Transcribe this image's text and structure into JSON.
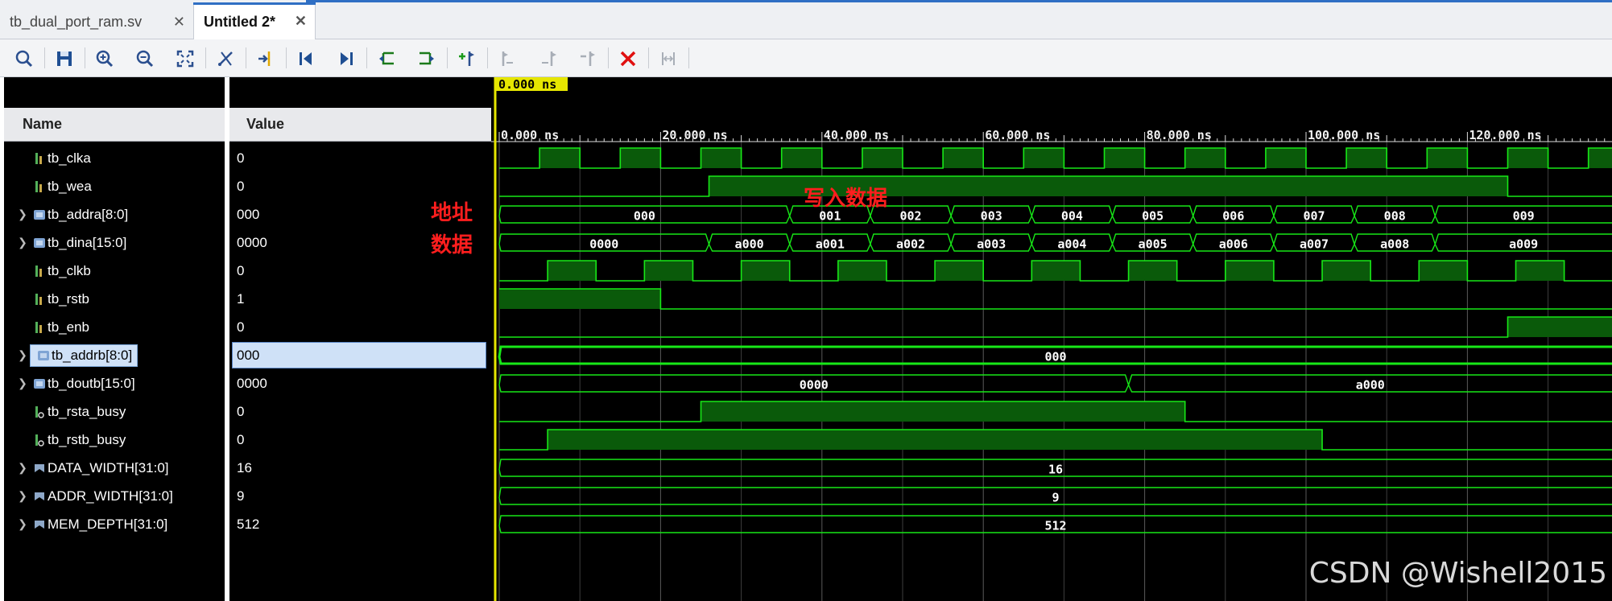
{
  "tabs": [
    {
      "label": "tb_dual_port_ram.sv",
      "active": false
    },
    {
      "label": "Untitled 2*",
      "active": true
    }
  ],
  "toolbar": {
    "buttons": [
      "search-icon",
      "save-icon",
      "zoom-in-icon",
      "zoom-out-icon",
      "zoom-fit-icon",
      "swap-cursor-icon",
      "go-to-cursor-icon",
      "go-to-start-icon",
      "go-to-end-icon",
      "previous-transition-icon",
      "next-transition-icon",
      "add-marker-icon",
      "previous-marker-icon",
      "next-marker-icon",
      "remove-marker-icon",
      "delete-icon",
      "snap-icon"
    ]
  },
  "columns": {
    "name": "Name",
    "value": "Value"
  },
  "signals": [
    {
      "name": "tb_clka",
      "value": "0",
      "expandable": false,
      "icon": "logic-signal-icon"
    },
    {
      "name": "tb_wea",
      "value": "0",
      "expandable": false,
      "icon": "logic-signal-icon"
    },
    {
      "name": "tb_addra[8:0]",
      "value": "000",
      "expandable": true,
      "icon": "bus-signal-icon"
    },
    {
      "name": "tb_dina[15:0]",
      "value": "0000",
      "expandable": true,
      "icon": "bus-signal-icon"
    },
    {
      "name": "tb_clkb",
      "value": "0",
      "expandable": false,
      "icon": "logic-signal-icon"
    },
    {
      "name": "tb_rstb",
      "value": "1",
      "expandable": false,
      "icon": "logic-signal-icon"
    },
    {
      "name": "tb_enb",
      "value": "0",
      "expandable": false,
      "icon": "logic-signal-icon"
    },
    {
      "name": "tb_addrb[8:0]",
      "value": "000",
      "expandable": true,
      "icon": "bus-signal-icon",
      "selected": true
    },
    {
      "name": "tb_doutb[15:0]",
      "value": "0000",
      "expandable": true,
      "icon": "bus-signal-icon"
    },
    {
      "name": "tb_rsta_busy",
      "value": "0",
      "expandable": false,
      "icon": "output-signal-icon"
    },
    {
      "name": "tb_rstb_busy",
      "value": "0",
      "expandable": false,
      "icon": "output-signal-icon"
    },
    {
      "name": "DATA_WIDTH[31:0]",
      "value": "16",
      "expandable": true,
      "icon": "parameter-icon"
    },
    {
      "name": "ADDR_WIDTH[31:0]",
      "value": "9",
      "expandable": true,
      "icon": "parameter-icon"
    },
    {
      "name": "MEM_DEPTH[31:0]",
      "value": "512",
      "expandable": true,
      "icon": "parameter-icon"
    }
  ],
  "annotations": {
    "address": "地址",
    "data": "数据",
    "write_data": "写入数据"
  },
  "cursor": {
    "label": "0.000 ns"
  },
  "watermark": "CSDN @Wishell2015",
  "time_ruler": {
    "unit": "ns",
    "labels": [
      "0.000 ns",
      "20.000 ns",
      "40.000 ns",
      "60.000 ns",
      "80.000 ns",
      "100.000 ns",
      "120.000 ns"
    ],
    "major_values": [
      0,
      20,
      40,
      60,
      80,
      100,
      120
    ],
    "visible_range_ns": [
      0,
      138.6
    ]
  },
  "waveforms": {
    "tb_clka": {
      "type": "clock",
      "period": 10,
      "high_start": 5
    },
    "tb_wea": {
      "type": "logic",
      "segments": [
        [
          0,
          26,
          0
        ],
        [
          26,
          125,
          1
        ],
        [
          125,
          140,
          0
        ]
      ]
    },
    "tb_addra": {
      "type": "bus",
      "segments": [
        [
          0,
          36,
          "000"
        ],
        [
          36,
          46,
          "001"
        ],
        [
          46,
          56,
          "002"
        ],
        [
          56,
          66,
          "003"
        ],
        [
          66,
          76,
          "004"
        ],
        [
          76,
          86,
          "005"
        ],
        [
          86,
          96,
          "006"
        ],
        [
          96,
          106,
          "007"
        ],
        [
          106,
          116,
          "008"
        ],
        [
          116,
          140,
          "009"
        ]
      ]
    },
    "tb_dina": {
      "type": "bus",
      "segments": [
        [
          0,
          26,
          "0000"
        ],
        [
          26,
          36,
          "a000"
        ],
        [
          36,
          46,
          "a001"
        ],
        [
          46,
          56,
          "a002"
        ],
        [
          56,
          66,
          "a003"
        ],
        [
          66,
          76,
          "a004"
        ],
        [
          76,
          86,
          "a005"
        ],
        [
          86,
          96,
          "a006"
        ],
        [
          96,
          106,
          "a007"
        ],
        [
          106,
          116,
          "a008"
        ],
        [
          116,
          140,
          "a009"
        ]
      ]
    },
    "tb_clkb": {
      "type": "clock",
      "period": 12,
      "high_start": 6
    },
    "tb_rstb": {
      "type": "logic",
      "segments": [
        [
          0,
          20,
          1
        ],
        [
          20,
          140,
          0
        ]
      ]
    },
    "tb_enb": {
      "type": "logic",
      "segments": [
        [
          0,
          125,
          0
        ],
        [
          125,
          140,
          1
        ]
      ]
    },
    "tb_addrb": {
      "type": "bus",
      "segments": [
        [
          0,
          140,
          "000"
        ]
      ],
      "highlight": true
    },
    "tb_doutb": {
      "type": "bus",
      "segments": [
        [
          0,
          78,
          "0000"
        ],
        [
          78,
          140,
          "a000"
        ]
      ]
    },
    "tb_rsta_busy": {
      "type": "logic",
      "segments": [
        [
          0,
          25,
          0
        ],
        [
          25,
          85,
          1
        ],
        [
          85,
          140,
          0
        ]
      ]
    },
    "tb_rstb_busy": {
      "type": "logic",
      "segments": [
        [
          0,
          6,
          0
        ],
        [
          6,
          102,
          1
        ],
        [
          102,
          140,
          0
        ]
      ]
    },
    "DATA_WIDTH": {
      "type": "bus",
      "segments": [
        [
          0,
          140,
          "16"
        ]
      ]
    },
    "ADDR_WIDTH": {
      "type": "bus",
      "segments": [
        [
          0,
          140,
          "9"
        ]
      ]
    },
    "MEM_DEPTH": {
      "type": "bus",
      "segments": [
        [
          0,
          140,
          "512"
        ]
      ]
    }
  },
  "colors": {
    "wave": "#17e817",
    "wave_fill": "#0a5a0a",
    "cursor": "#e6e600",
    "grid": "#5a5a5a",
    "selection": "#cfe1f7",
    "annotation": "#ff1e1e"
  }
}
